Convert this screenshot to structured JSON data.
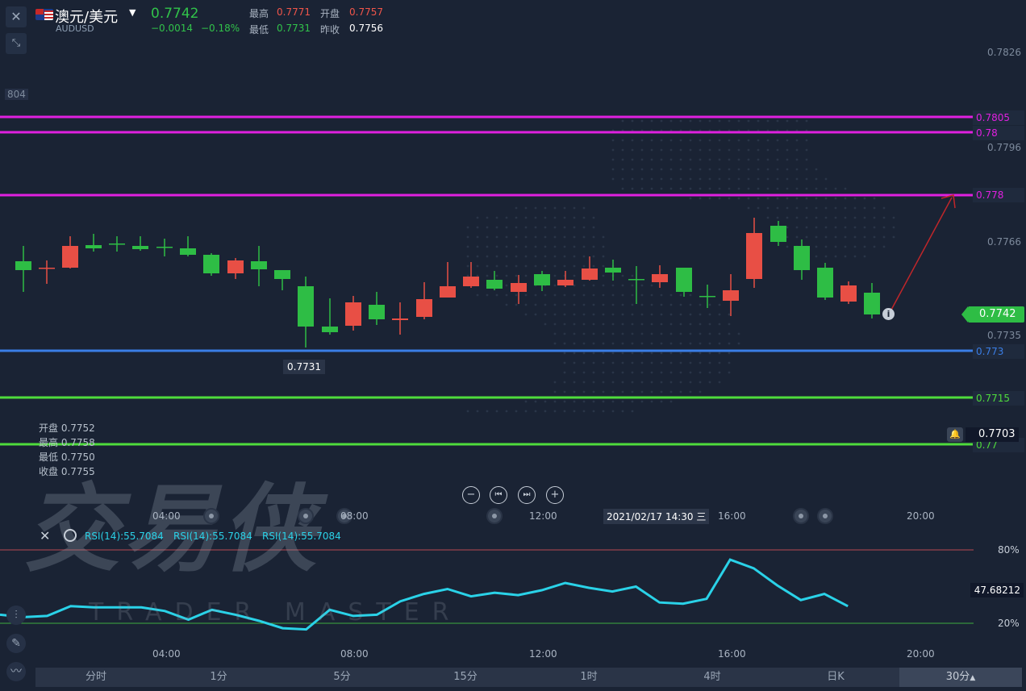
{
  "header": {
    "symbol_name": "澳元/美元",
    "symbol_code": "AUDUSD",
    "price": "0.7742",
    "change": "−0.0014",
    "change_pct": "−0.18%",
    "high_label": "最高",
    "high_value": "0.7771",
    "open_label": "开盘",
    "open_value": "0.7757",
    "low_label": "最低",
    "low_value": "0.7731",
    "prev_close_label": "昨收",
    "prev_close_value": "0.7756"
  },
  "price_axis": {
    "ticks": [
      "0.7826",
      "0.7796",
      "0.7766",
      "0.7735"
    ],
    "left_cut_label": "804"
  },
  "levels": [
    {
      "label": "0.7805",
      "color": "#e020e0"
    },
    {
      "label": "0.78",
      "color": "#e020e0"
    },
    {
      "label": "0.778",
      "color": "#e020e0"
    },
    {
      "label": "0.773",
      "color": "#3a7ee6"
    },
    {
      "label": "0.7715",
      "color": "#4fdc3c"
    },
    {
      "label": "0.77",
      "color": "#4fdc3c"
    }
  ],
  "current_price_tag": "0.7742",
  "crosshair_price": "0.7703",
  "low_marker": "0.7731",
  "ohlc_info": {
    "open": "开盘 0.7752",
    "high": "最高 0.7758",
    "low": "最低 0.7750",
    "close": "收盘 0.7755"
  },
  "time_axis": {
    "ticks": [
      "04:00",
      "08:00",
      "12:00",
      "16:00",
      "20:00"
    ],
    "crosshair_time": "2021/02/17 14:30 三"
  },
  "rsi": {
    "labels": [
      "RSI(14):55.7084",
      "RSI(14):55.7084",
      "RSI(14):55.7084"
    ],
    "level_80": "80%",
    "level_20": "20%",
    "value_tag": "47.68212",
    "time_ticks": [
      "04:00",
      "08:00",
      "12:00",
      "16:00",
      "20:00"
    ],
    "values": [
      27,
      25,
      26,
      34,
      33,
      33,
      33,
      30,
      23,
      31,
      27,
      22,
      16,
      15,
      31,
      26,
      27,
      38,
      44,
      48,
      42,
      45,
      43,
      47,
      53,
      49,
      46,
      50,
      37,
      36,
      40,
      72,
      65,
      51,
      39,
      44,
      34
    ]
  },
  "tabs": [
    "分时",
    "1分",
    "5分",
    "15分",
    "1时",
    "4时",
    "日K",
    "30分"
  ],
  "active_tab": "30分",
  "watermark": {
    "main": "交易侠",
    "sub": "TRADER MASTER"
  },
  "colors": {
    "up": "#e84f45",
    "down": "#2ebd45",
    "bg": "#1a2334"
  }
}
